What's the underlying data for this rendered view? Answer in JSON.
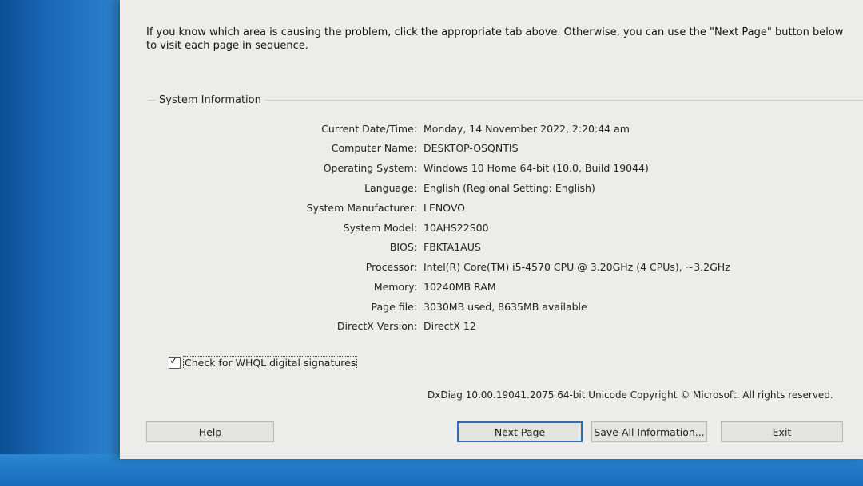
{
  "intro_text": "If you know which area is causing the problem, click the appropriate tab above. Otherwise, you can use the \"Next Page\" button below to visit each page in sequence.",
  "group_title": "System Information",
  "system_info": [
    {
      "label": "Current Date/Time:",
      "value": "Monday, 14 November 2022, 2:20:44 am"
    },
    {
      "label": "Computer Name:",
      "value": "DESKTOP-OSQNTIS"
    },
    {
      "label": "Operating System:",
      "value": "Windows 10 Home 64-bit (10.0, Build 19044)"
    },
    {
      "label": "Language:",
      "value": "English (Regional Setting: English)"
    },
    {
      "label": "System Manufacturer:",
      "value": "LENOVO"
    },
    {
      "label": "System Model:",
      "value": "10AHS22S00"
    },
    {
      "label": "BIOS:",
      "value": "FBKTA1AUS"
    },
    {
      "label": "Processor:",
      "value": "Intel(R) Core(TM) i5-4570 CPU @ 3.20GHz (4 CPUs), ~3.2GHz"
    },
    {
      "label": "Memory:",
      "value": "10240MB RAM"
    },
    {
      "label": "Page file:",
      "value": "3030MB used, 8635MB available"
    },
    {
      "label": "DirectX Version:",
      "value": "DirectX 12"
    }
  ],
  "whql_checkbox": {
    "label": "Check for WHQL digital signatures",
    "checked": true
  },
  "copyright": "DxDiag 10.00.19041.2075 64-bit Unicode  Copyright © Microsoft. All rights reserved.",
  "buttons": {
    "help": "Help",
    "next_page": "Next Page",
    "save_all": "Save All Information...",
    "exit": "Exit"
  }
}
